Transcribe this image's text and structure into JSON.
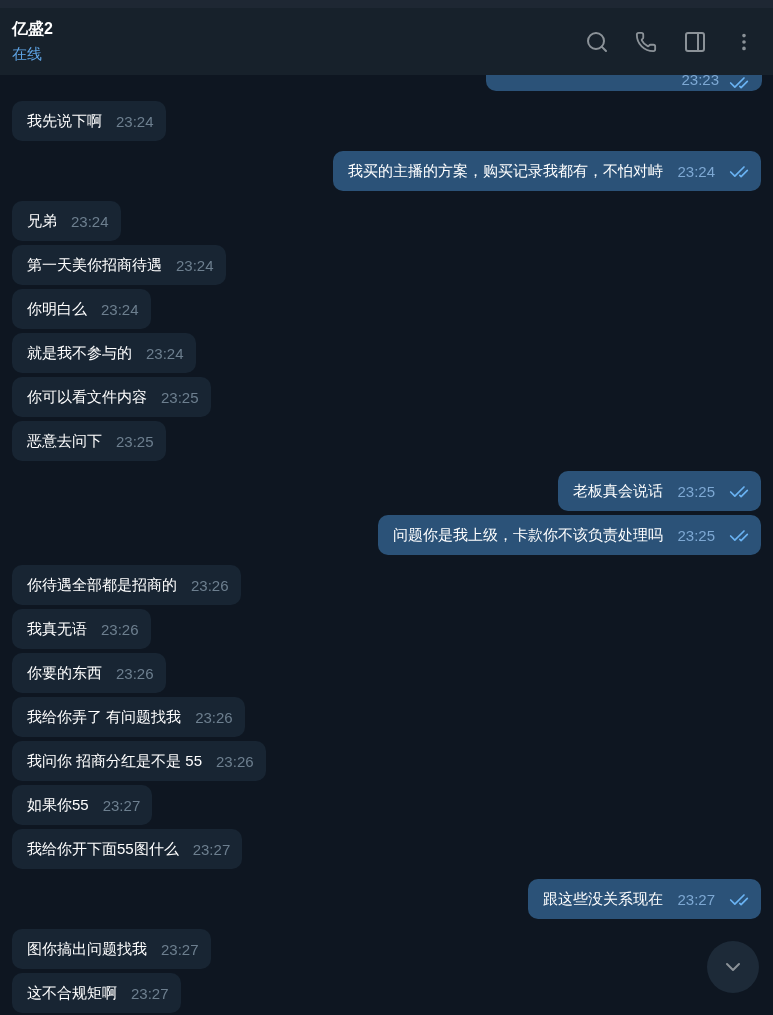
{
  "header": {
    "title": "亿盛2",
    "status": "在线"
  },
  "top_partial": {
    "time": "23:23",
    "read": true
  },
  "groups": [
    {
      "kind": "incoming",
      "messages": [
        {
          "text": "我先说下啊",
          "time": "23:24"
        }
      ]
    },
    {
      "kind": "outgoing",
      "messages": [
        {
          "text": "我买的主播的方案，购买记录我都有，不怕对峙",
          "time": "23:24",
          "read": true
        }
      ]
    },
    {
      "kind": "incoming",
      "messages": [
        {
          "text": "兄弟",
          "time": "23:24"
        },
        {
          "text": "第一天美你招商待遇",
          "time": "23:24"
        },
        {
          "text": "你明白么",
          "time": "23:24"
        },
        {
          "text": "就是我不参与的",
          "time": "23:24"
        },
        {
          "text": "你可以看文件内容",
          "time": "23:25"
        },
        {
          "text": "恶意去问下",
          "time": "23:25"
        }
      ]
    },
    {
      "kind": "outgoing",
      "messages": [
        {
          "text": "老板真会说话",
          "time": "23:25",
          "read": true
        },
        {
          "text": "问题你是我上级，卡款你不该负责处理吗",
          "time": "23:25",
          "read": true
        }
      ]
    },
    {
      "kind": "incoming",
      "messages": [
        {
          "text": "你待遇全部都是招商的",
          "time": "23:26"
        },
        {
          "text": "我真无语",
          "time": "23:26"
        },
        {
          "text": "你要的东西",
          "time": "23:26"
        },
        {
          "text": "我给你弄了 有问题找我",
          "time": "23:26"
        },
        {
          "text": "我问你 招商分红是不是 55",
          "time": "23:26"
        },
        {
          "text": "如果你55",
          "time": "23:27"
        },
        {
          "text": "我给你开下面55图什么",
          "time": "23:27"
        }
      ]
    },
    {
      "kind": "outgoing",
      "messages": [
        {
          "text": "跟这些没关系现在",
          "time": "23:27",
          "read": true
        }
      ]
    },
    {
      "kind": "incoming",
      "messages": [
        {
          "text": "图你搞出问题找我",
          "time": "23:27"
        },
        {
          "text": "这不合规矩啊",
          "time": "23:27"
        }
      ]
    }
  ]
}
